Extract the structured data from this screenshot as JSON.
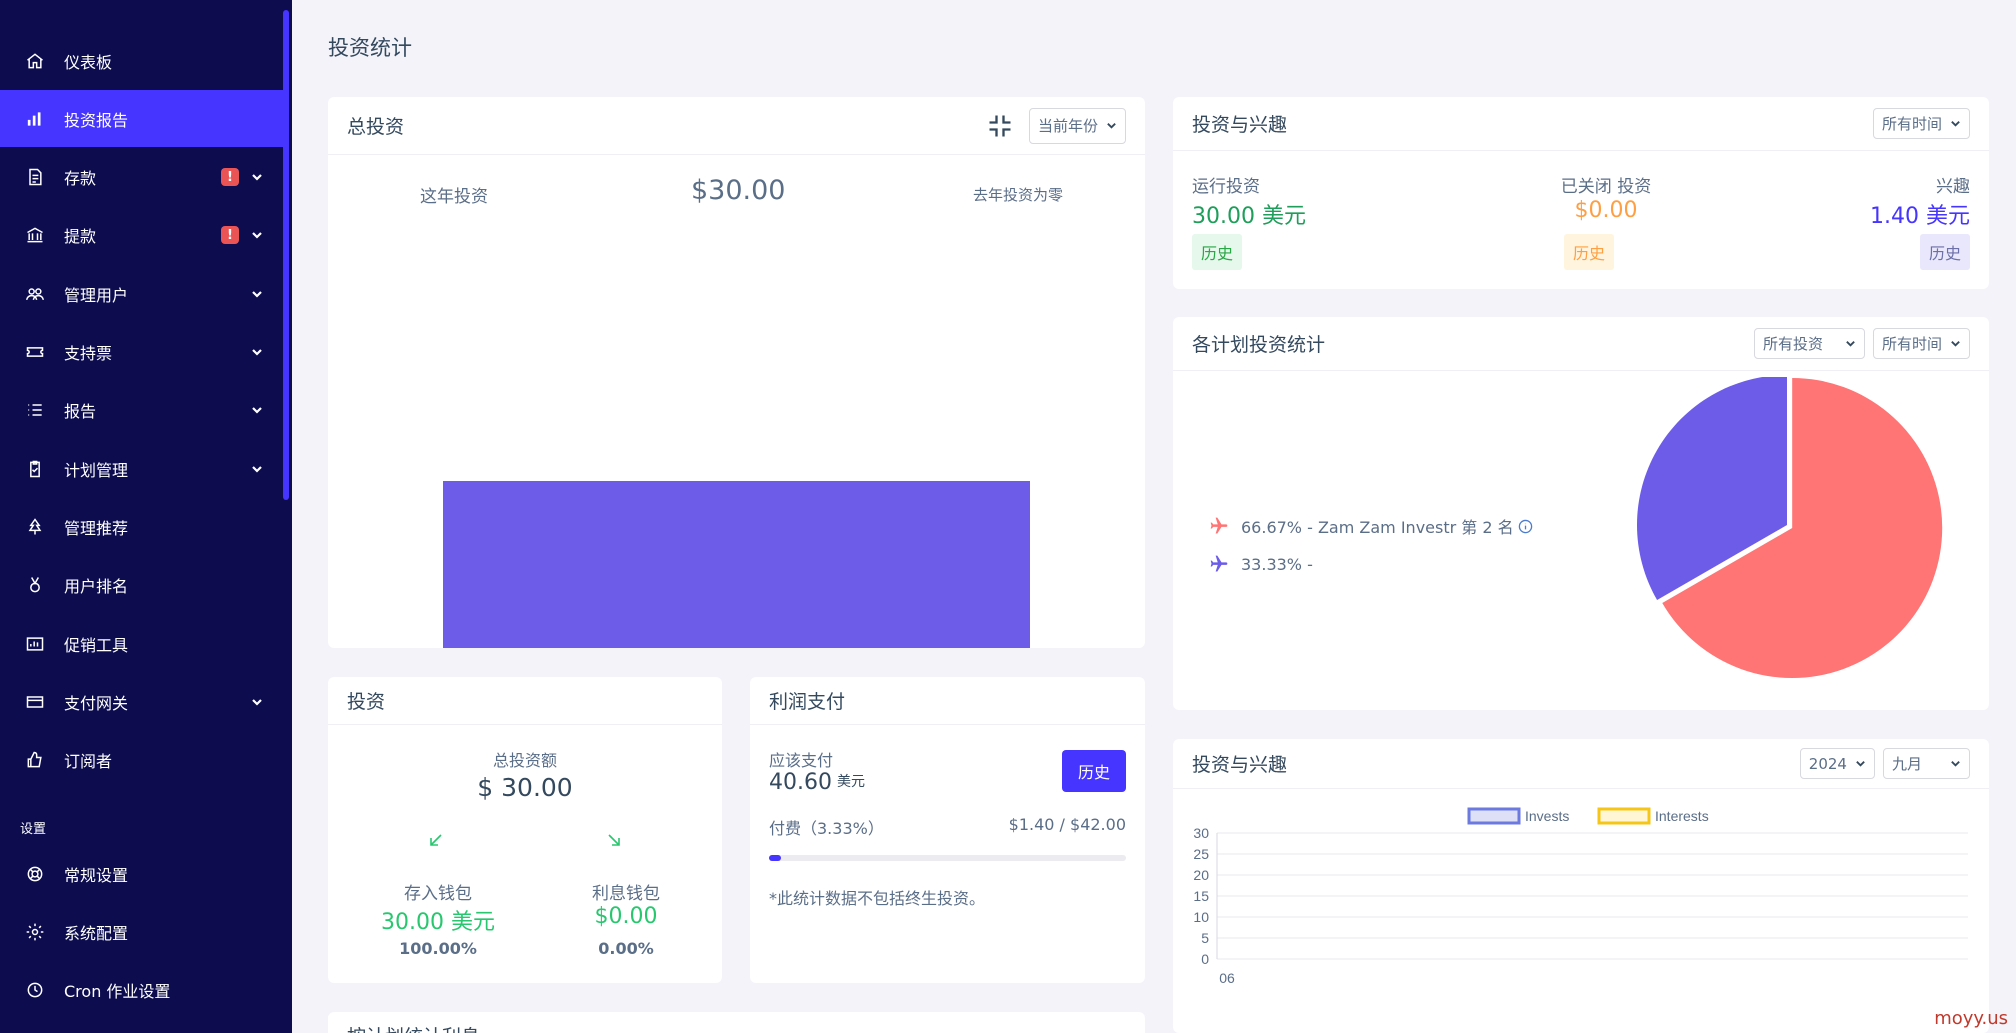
{
  "sidebar": {
    "items": [
      {
        "label": "仪表板",
        "icon": "home-icon",
        "active": false,
        "alert": false,
        "chevron": false
      },
      {
        "label": "投资报告",
        "icon": "bar-chart-icon",
        "active": true,
        "alert": false,
        "chevron": false
      },
      {
        "label": "存款",
        "icon": "deposit-icon",
        "active": false,
        "alert": true,
        "chevron": true
      },
      {
        "label": "提款",
        "icon": "bank-icon",
        "active": false,
        "alert": true,
        "chevron": true
      },
      {
        "label": "管理用户",
        "icon": "users-icon",
        "active": false,
        "alert": false,
        "chevron": true
      },
      {
        "label": "支持票",
        "icon": "ticket-icon",
        "active": false,
        "alert": false,
        "chevron": true
      },
      {
        "label": "报告",
        "icon": "list-icon",
        "active": false,
        "alert": false,
        "chevron": true
      },
      {
        "label": "计划管理",
        "icon": "clipboard-icon",
        "active": false,
        "alert": false,
        "chevron": true
      },
      {
        "label": "管理推荐",
        "icon": "tree-icon",
        "active": false,
        "alert": false,
        "chevron": false
      },
      {
        "label": "用户排名",
        "icon": "medal-icon",
        "active": false,
        "alert": false,
        "chevron": false
      },
      {
        "label": "促销工具",
        "icon": "chart-box-icon",
        "active": false,
        "alert": false,
        "chevron": false
      },
      {
        "label": "支付网关",
        "icon": "credit-card-icon",
        "active": false,
        "alert": false,
        "chevron": true
      },
      {
        "label": "订阅者",
        "icon": "thumbs-up-icon",
        "active": false,
        "alert": false,
        "chevron": false
      }
    ],
    "section_label": "设置",
    "settings_items": [
      {
        "label": "常规设置",
        "icon": "lifebuoy-icon"
      },
      {
        "label": "系统配置",
        "icon": "gear-icon"
      },
      {
        "label": "Cron 作业设置",
        "icon": "clock-icon"
      }
    ],
    "alert_mark": "!"
  },
  "page_title": "投资统计",
  "total_investment": {
    "title": "总投资",
    "year_select": "当前年份",
    "this_year_label": "这年投资",
    "amount": "$30.00",
    "last_year_note": "去年投资为零"
  },
  "invest_interest": {
    "title": "投资与兴趣",
    "time_select": "所有时间",
    "running_label": "运行投资",
    "running_value": "30.00 美元",
    "closed_label": "已关闭 投资",
    "closed_value": "$0.00",
    "interest_label": "兴趣",
    "interest_value": "1.40 美元",
    "history_label": "历史"
  },
  "plan_stats": {
    "title": "各计划投资统计",
    "invest_select": "所有投资",
    "time_select": "所有时间",
    "legend": [
      {
        "text": "66.67% - Zam Zam Investr 第 2 名",
        "color": "#ff7474"
      },
      {
        "text": "33.33% -",
        "color": "#6c5ce7"
      }
    ]
  },
  "investment": {
    "title": "投资",
    "total_label": "总投资额",
    "total_value": "$ 30.00",
    "deposit_wallet_label": "存入钱包",
    "deposit_wallet_value": "30.00 美元",
    "deposit_wallet_pct": "100.00%",
    "interest_wallet_label": "利息钱包",
    "interest_wallet_value": "$0.00",
    "interest_wallet_pct": "0.00%"
  },
  "profit": {
    "title": "利润支付",
    "due_label": "应该支付",
    "due_value": "40.60",
    "due_unit": "美元",
    "history_btn": "历史",
    "fee_label": "付费（3.33%）",
    "fee_value": "$1.40 / $42.00",
    "progress": 0.0333,
    "note": "*此统计数据不包括终生投资。"
  },
  "trend": {
    "title": "投资与兴趣",
    "year_select": "2024",
    "month_select": "九月"
  },
  "bottom_card_title": "按计划统计利息",
  "watermark": "moyy.us",
  "colors": {
    "accent": "#4634ff",
    "bar": "#6c5ce7",
    "pie_a": "#ff7474",
    "pie_b": "#6c5ce7",
    "sidebar": "#0c0c4f"
  },
  "chart_data": [
    {
      "type": "bar",
      "categories": [
        ""
      ],
      "values": [
        30
      ],
      "ylim": [
        0,
        60
      ]
    },
    {
      "type": "pie",
      "labels": [
        "Zam Zam Investr 第 2 名",
        ""
      ],
      "values": [
        66.67,
        33.33
      ]
    },
    {
      "type": "line",
      "x": [
        "06"
      ],
      "series": [
        {
          "name": "Invests",
          "values": [
            0
          ]
        },
        {
          "name": "Interests",
          "values": [
            0
          ]
        }
      ],
      "yticks": [
        0,
        5,
        10,
        15,
        20,
        25,
        30
      ],
      "ylim": [
        0,
        30
      ],
      "legend_position": "top"
    }
  ]
}
